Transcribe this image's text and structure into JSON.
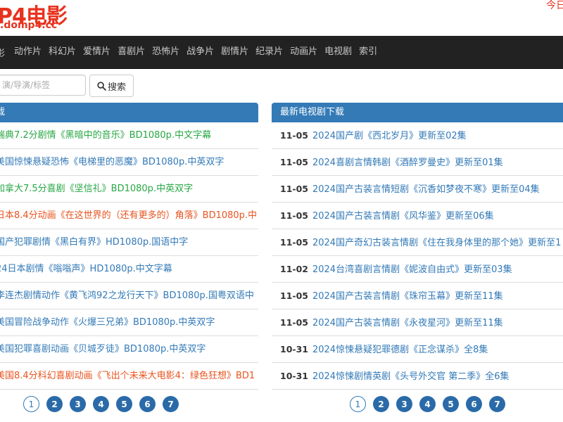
{
  "header": {
    "logo_main": "P4电影",
    "logo_sub": ".domp4.cc",
    "today_link": "今日"
  },
  "nav": {
    "brand": "影",
    "items": [
      "动作片",
      "科幻片",
      "爱情片",
      "喜剧片",
      "恐怖片",
      "战争片",
      "剧情片",
      "纪录片",
      "动画片",
      "电视剧",
      "索引"
    ]
  },
  "search": {
    "placeholder": "演/导演/标签",
    "button_label": "搜索"
  },
  "movies_panel": {
    "title": "载",
    "items": [
      {
        "text": "瑞典7.2分剧情《黑暗中的音乐》BD1080p.中文字幕",
        "color": "#27a844"
      },
      {
        "text": "美国惊悚悬疑恐怖《电梯里的恶魔》BD1080p.中英双字",
        "color": "#337ab7"
      },
      {
        "text": "加拿大7.5分喜剧《坚信礼》BD1080p.中英双字",
        "color": "#27a844"
      },
      {
        "text": "日本8.4分动画《在这世界的（还有更多的）角落》BD1080p.中",
        "color": "#e8531e"
      },
      {
        "text": "国产犯罪剧情《黑白有界》HD1080p.国语中字",
        "color": "#337ab7"
      },
      {
        "text": "24日本剧情《嗡嗡声》HD1080p.中文字幕",
        "color": "#337ab7"
      },
      {
        "text": "李连杰剧情动作《黄飞鸿92之龙行天下》BD1080p.国粤双语中",
        "color": "#337ab7"
      },
      {
        "text": "美国冒险战争动作《火爆三兄弟》BD1080p.中英双字",
        "color": "#337ab7"
      },
      {
        "text": "美国犯罪喜剧动画《贝城歹徒》BD1080p.中英双字",
        "color": "#337ab7"
      },
      {
        "text": "美国8.4分科幻喜剧动画《飞出个未来大电影4：绿色狂想》BD1",
        "color": "#e8531e"
      }
    ]
  },
  "tv_panel": {
    "title": "最新电视剧下载",
    "items": [
      {
        "date": "11-05",
        "text": "2024国产剧《西北岁月》更新至02集"
      },
      {
        "date": "11-05",
        "text": "2024喜剧言情韩剧《酒醉罗曼史》更新至01集"
      },
      {
        "date": "11-05",
        "text": "2024国产古装言情短剧《沉香如梦夜不寒》更新至04集"
      },
      {
        "date": "11-05",
        "text": "2024国产古装言情剧《风华鉴》更新至06集"
      },
      {
        "date": "11-05",
        "text": "2024国产奇幻古装言情剧《住在我身体里的那个她》更新至1"
      },
      {
        "date": "11-02",
        "text": "2024台湾喜剧言情剧《妮波自由式》更新至03集"
      },
      {
        "date": "11-05",
        "text": "2024国产古装言情剧《珠帘玉幕》更新至11集"
      },
      {
        "date": "11-05",
        "text": "2024国产古装言情剧《永夜星河》更新至11集"
      },
      {
        "date": "10-31",
        "text": "2024惊悚悬疑犯罪德剧《正念谋杀》全8集"
      },
      {
        "date": "10-31",
        "text": "2024惊悚剧情英剧《头号外交官 第二季》全6集"
      }
    ]
  },
  "pagination_left": [
    "1",
    "2",
    "3",
    "4",
    "5",
    "6",
    "7"
  ],
  "pagination_right": [
    "1",
    "2",
    "3",
    "4",
    "5",
    "6",
    "7"
  ],
  "colors": {
    "brand_red": "#e8321e",
    "navbar_bg": "#222222",
    "panel_blue": "#337ab7",
    "link_green": "#27a844",
    "link_orange": "#e8531e"
  }
}
